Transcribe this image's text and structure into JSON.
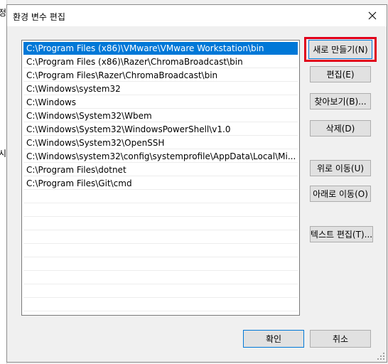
{
  "background": {
    "char_top": "정",
    "char_mid": "시"
  },
  "dialog": {
    "title": "환경 변수 편집",
    "close_glyph": "✕"
  },
  "list": {
    "items": [
      "C:\\Program Files (x86)\\VMware\\VMware Workstation\\bin",
      "C:\\Program Files (x86)\\Razer\\ChromaBroadcast\\bin",
      "C:\\Program Files\\Razer\\ChromaBroadcast\\bin",
      "C:\\Windows\\system32",
      "C:\\Windows",
      "C:\\Windows\\System32\\Wbem",
      "C:\\Windows\\System32\\WindowsPowerShell\\v1.0",
      "C:\\Windows\\System32\\OpenSSH",
      "C:\\Windows\\system32\\config\\systemprofile\\AppData\\Local\\Mi...",
      "C:\\Program Files\\dotnet",
      "C:\\Program Files\\Git\\cmd"
    ],
    "selected_index": 0,
    "empty_rows": 9
  },
  "buttons": {
    "new": "새로 만들기(N)",
    "edit": "편집(E)",
    "browse": "찾아보기(B)...",
    "delete": "삭제(D)",
    "move_up": "위로 이동(U)",
    "move_down": "아래로 이동(O)",
    "edit_text": "텍스트 편집(T)...",
    "ok": "확인",
    "cancel": "취소"
  },
  "colors": {
    "selection": "#0078d7",
    "highlight": "#e0001b",
    "button_face": "#e1e1e1"
  }
}
